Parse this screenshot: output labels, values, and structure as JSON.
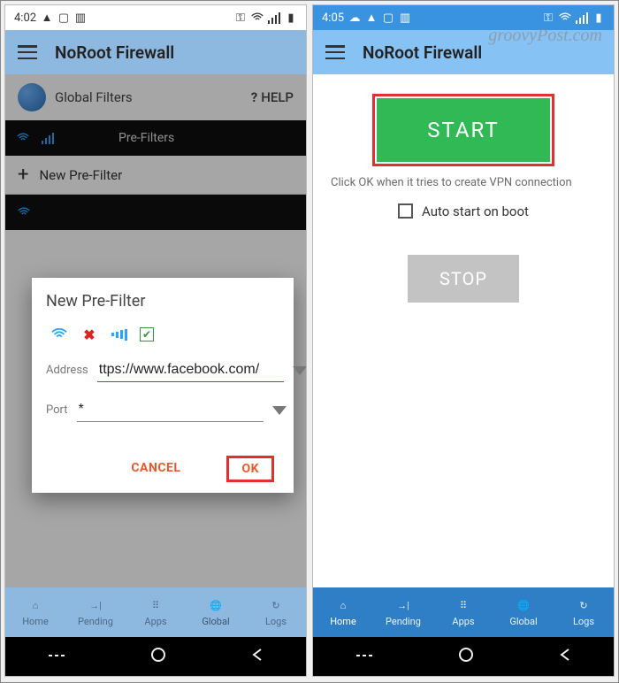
{
  "watermark": "groovyPost.com",
  "left": {
    "status": {
      "time": "4:02"
    },
    "app_title": "NoRoot Firewall",
    "global_filters": "Global Filters",
    "help": "HELP",
    "tab_label": "Pre-Filters",
    "new_filter": "New Pre-Filter",
    "dialog": {
      "title": "New Pre-Filter",
      "address_label": "Address",
      "address_value": "ttps://www.facebook.com/",
      "port_label": "Port",
      "port_value": "*",
      "cancel": "CANCEL",
      "ok": "OK"
    },
    "nav": {
      "home": "Home",
      "pending": "Pending",
      "apps": "Apps",
      "global": "Global",
      "logs": "Logs"
    }
  },
  "right": {
    "status": {
      "time": "4:05"
    },
    "app_title": "NoRoot Firewall",
    "start": "START",
    "instruction": "Click OK when it tries to create VPN connection",
    "auto_start": "Auto start on boot",
    "stop": "STOP",
    "nav": {
      "home": "Home",
      "pending": "Pending",
      "apps": "Apps",
      "global": "Global",
      "logs": "Logs"
    }
  }
}
